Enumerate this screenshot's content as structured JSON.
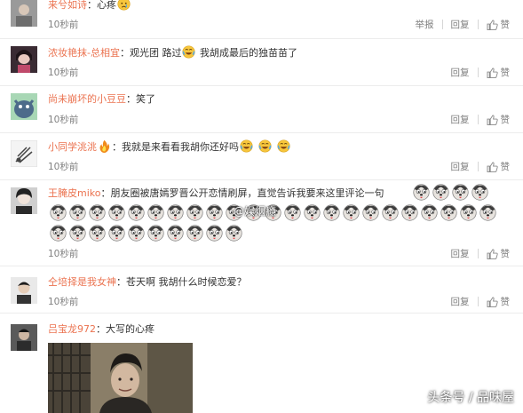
{
  "comments": [
    {
      "user": "来兮如诗",
      "text": "：心疼",
      "time": "10秒前"
    },
    {
      "user": "浓妆艳抹-总相宜",
      "text_a": "：观光团 路过",
      "text_b": " 我胡成最后的独苗苗了",
      "time": "10秒前"
    },
    {
      "user": "尚未崩坏的小豆豆",
      "text": "：笑了",
      "time": "10秒前"
    },
    {
      "user": "小同学洮洮",
      "text": "：我就是来看看我胡你还好吗",
      "time": "10秒前"
    },
    {
      "user": "王腌皮miko",
      "text": "：朋友圈被唐嫣罗晋公开恋情刷屏，直觉告诉我要来这里评论一句",
      "time": "10秒前"
    },
    {
      "user": "仝培择是我女神",
      "text": "：苍天啊  我胡什么时候恋爱？",
      "time": "10秒前"
    },
    {
      "user": "吕宝龙972",
      "text": "：大写的心疼"
    }
  ],
  "actions": {
    "report": "举报",
    "reply": "回复",
    "like": "赞"
  },
  "watermark": "@娱烟瘾",
  "corner_watermark": "头条号 / 品味屋",
  "icons": {
    "like": "thumbs-up-icon",
    "laugh": "laugh-cry-emoji",
    "dog": "doge-emoji",
    "fire": "fire-emoji",
    "avatar": "avatar"
  }
}
